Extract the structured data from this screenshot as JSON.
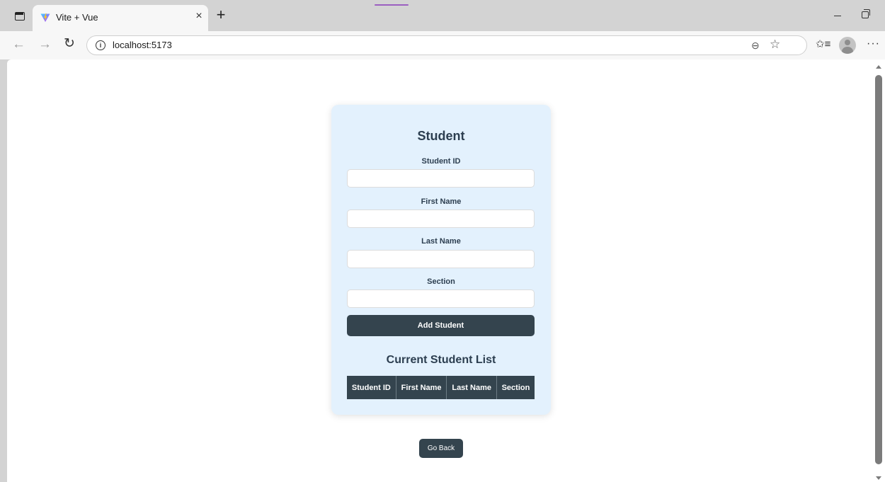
{
  "browser": {
    "tab_title": "Vite + Vue",
    "url": "localhost:5173",
    "icons": {
      "sidebar": "sidebar-toggle-icon",
      "favicon": "vite-logo-icon",
      "close": "close-icon",
      "new_tab": "plus-icon",
      "back": "arrow-left-icon",
      "forward": "arrow-right-icon",
      "reload": "reload-icon",
      "info": "info-icon",
      "zoom": "zoom-icon",
      "favorite": "star-icon",
      "favorites": "favorites-icon",
      "profile": "profile-avatar",
      "more": "more-icon"
    },
    "glyphs": {
      "close": "×",
      "new_tab": "+",
      "back": "←",
      "forward": "→",
      "reload": "↻",
      "info": "i",
      "zoom": "⊖",
      "favorite": "☆",
      "favorites": "✩≡",
      "more": "···"
    }
  },
  "form": {
    "title": "Student",
    "fields": [
      {
        "label": "Student ID",
        "value": "",
        "placeholder": ""
      },
      {
        "label": "First Name",
        "value": "",
        "placeholder": ""
      },
      {
        "label": "Last Name",
        "value": "",
        "placeholder": ""
      },
      {
        "label": "Section",
        "value": "",
        "placeholder": ""
      }
    ],
    "submit_label": "Add Student"
  },
  "list": {
    "title": "Current Student List",
    "columns": [
      "Student ID",
      "First Name",
      "Last Name",
      "Section"
    ],
    "rows": []
  },
  "go_back_label": "Go Back",
  "colors": {
    "card_bg": "#e3f1fd",
    "button_bg": "#34444e",
    "heading": "#2c3e50"
  }
}
